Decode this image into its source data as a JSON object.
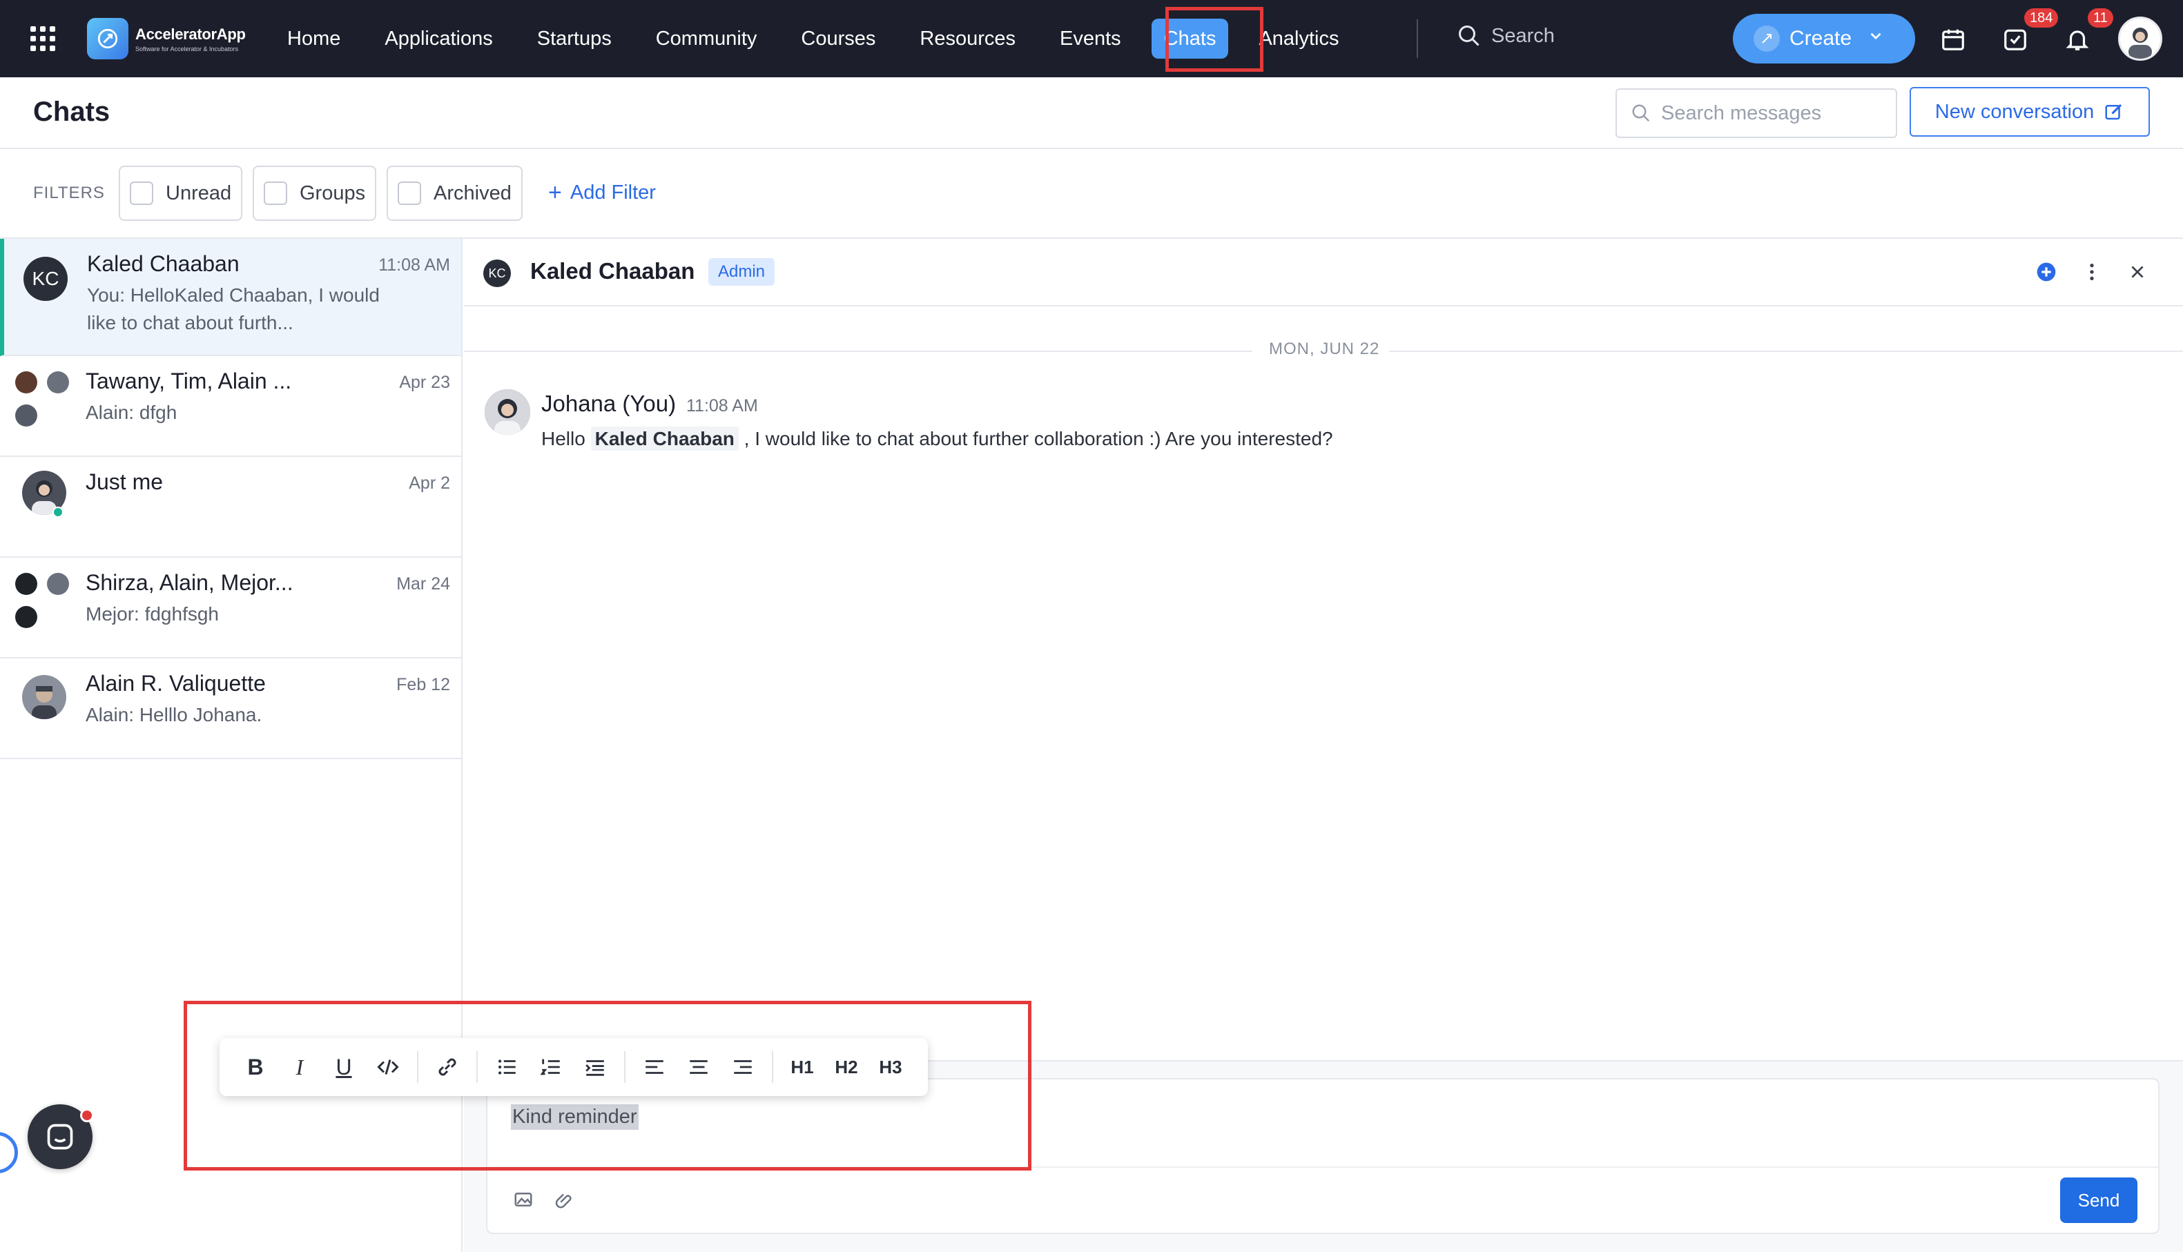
{
  "brand": {
    "name": "AcceleratorApp",
    "tagline": "Software for Accelerator & Incubators"
  },
  "nav": {
    "items": [
      {
        "label": "Home"
      },
      {
        "label": "Applications"
      },
      {
        "label": "Startups"
      },
      {
        "label": "Community"
      },
      {
        "label": "Courses"
      },
      {
        "label": "Resources"
      },
      {
        "label": "Events"
      },
      {
        "label": "Chats",
        "active": true
      },
      {
        "label": "Analytics"
      }
    ],
    "search_placeholder": "Search",
    "create_label": "Create",
    "tasks_badge": "184",
    "notifications_badge": "11"
  },
  "page": {
    "title": "Chats",
    "search_messages_placeholder": "Search messages",
    "new_conversation_label": "New conversation"
  },
  "filters": {
    "label": "FILTERS",
    "chips": [
      {
        "label": "Unread"
      },
      {
        "label": "Groups"
      },
      {
        "label": "Archived"
      }
    ],
    "add_filter_label": "Add Filter"
  },
  "conversations": [
    {
      "initials": "KC",
      "name": "Kaled Chaaban",
      "time": "11:08 AM",
      "preview": "You: HelloKaled Chaaban, I would like to chat about furth...",
      "active": true
    },
    {
      "name": "Tawany, Tim, Alain ...",
      "time": "Apr 23",
      "preview": "Alain: dfgh"
    },
    {
      "name": "Just me",
      "time": "Apr 2",
      "preview": ""
    },
    {
      "name": "Shirza, Alain, Mejor...",
      "time": "Mar 24",
      "preview": "Mejor: fdghfsgh"
    },
    {
      "name": "Alain R. Valiquette",
      "time": "Feb 12",
      "preview": "Alain: Helllo Johana."
    }
  ],
  "chat": {
    "initials": "KC",
    "name": "Kaled Chaaban",
    "role_tag": "Admin",
    "date_separator": "MON, JUN 22",
    "messages": [
      {
        "author": "Johana (You)",
        "time": "11:08 AM",
        "text_before": "Hello ",
        "mention": "Kaled Chaaban",
        "text_after": " , I would like to chat about further collaboration :) Are you interested?"
      }
    ]
  },
  "composer": {
    "text": "Kind reminder",
    "send_label": "Send"
  },
  "format_toolbar": {
    "h1": "H1",
    "h2": "H2",
    "h3": "H3"
  },
  "colors": {
    "nav_bg": "#1c1f2b",
    "accent": "#4a9af5",
    "primary": "#1f6ce3",
    "highlight_box": "#e23a3a",
    "active_row": "#eef4fc",
    "active_marker": "#1ab394"
  }
}
